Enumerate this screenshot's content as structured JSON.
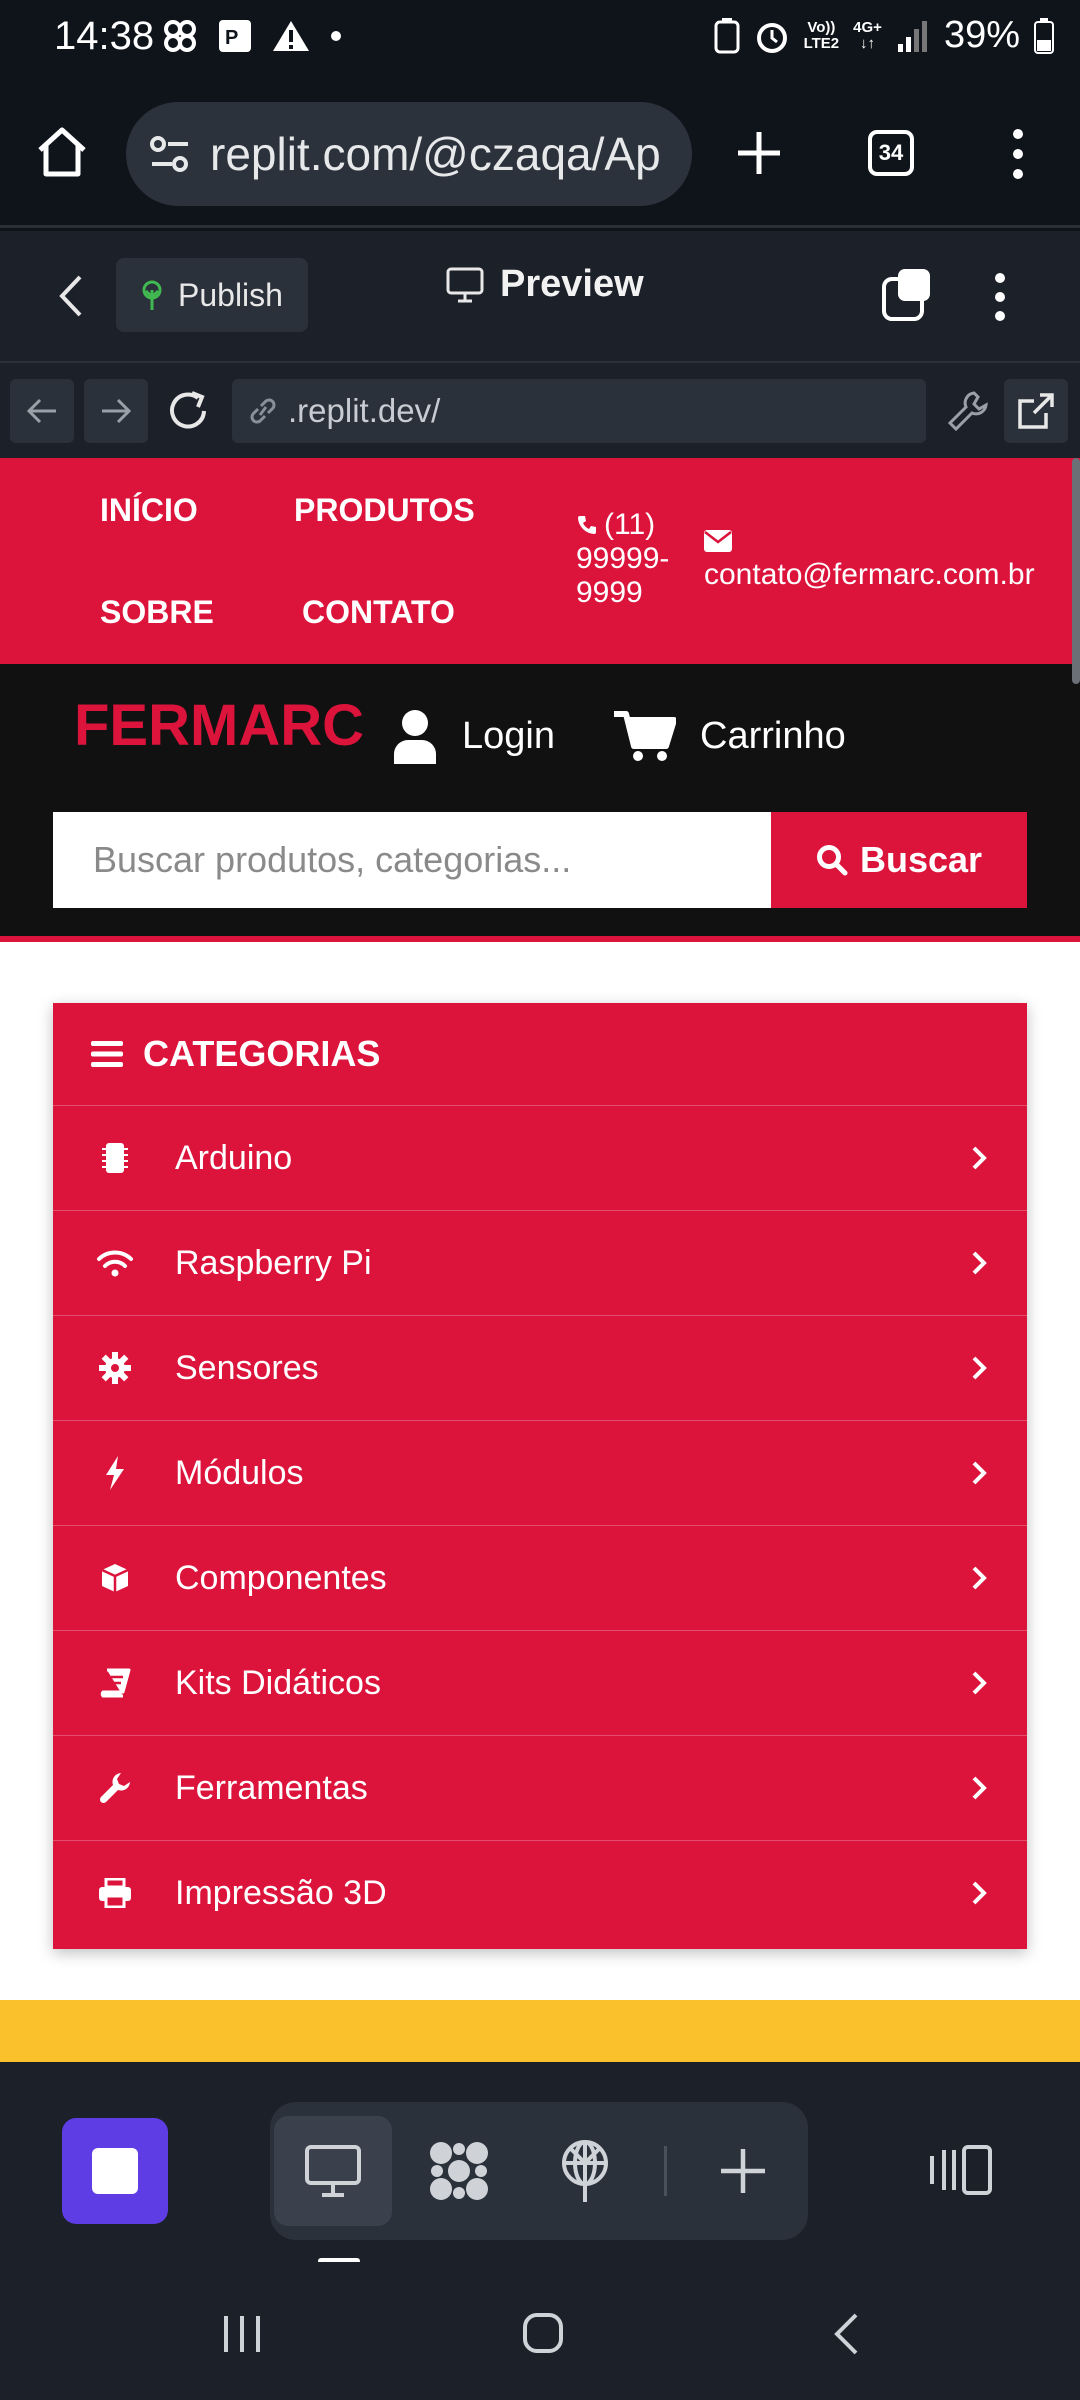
{
  "status_bar": {
    "time": "14:38",
    "battery": "39%",
    "network_top": "Vo))",
    "network_bottom": "LTE2",
    "net_gen": "4G+"
  },
  "browser": {
    "url": "replit.com/@czaqa/Ap",
    "tab_count": "34"
  },
  "replit_header": {
    "publish_label": "Publish",
    "preview_label": "Preview"
  },
  "devtools": {
    "url": ".replit.dev/"
  },
  "site": {
    "nav": {
      "home": "INÍCIO",
      "products": "PRODUTOS",
      "about": "SOBRE",
      "contact": "CONTATO"
    },
    "phone_line1": "(11)",
    "phone_line2": "99999-",
    "phone_line3": "9999",
    "email": "contato@fermarc.com.br",
    "logo": "FERMARC",
    "login_label": "Login",
    "cart_label": "Carrinho",
    "search": {
      "placeholder": "Buscar produtos, categorias...",
      "button_label": "Buscar"
    },
    "categories": {
      "title": "CATEGORIAS",
      "items": [
        {
          "label": "Arduino",
          "icon": "microchip-icon"
        },
        {
          "label": "Raspberry Pi",
          "icon": "wifi-icon"
        },
        {
          "label": "Sensores",
          "icon": "gear-icon"
        },
        {
          "label": "Módulos",
          "icon": "bolt-icon"
        },
        {
          "label": "Componentes",
          "icon": "cube-icon"
        },
        {
          "label": "Kits Didáticos",
          "icon": "book-icon"
        },
        {
          "label": "Ferramentas",
          "icon": "wrench-icon"
        },
        {
          "label": "Impressão 3D",
          "icon": "printer-icon"
        }
      ]
    }
  },
  "colors": {
    "brand_red": "#dc143c",
    "dark": "#111111",
    "replit_bg": "#1c2029",
    "accent_purple": "#5f3de4",
    "yellow": "#fbc12d"
  }
}
